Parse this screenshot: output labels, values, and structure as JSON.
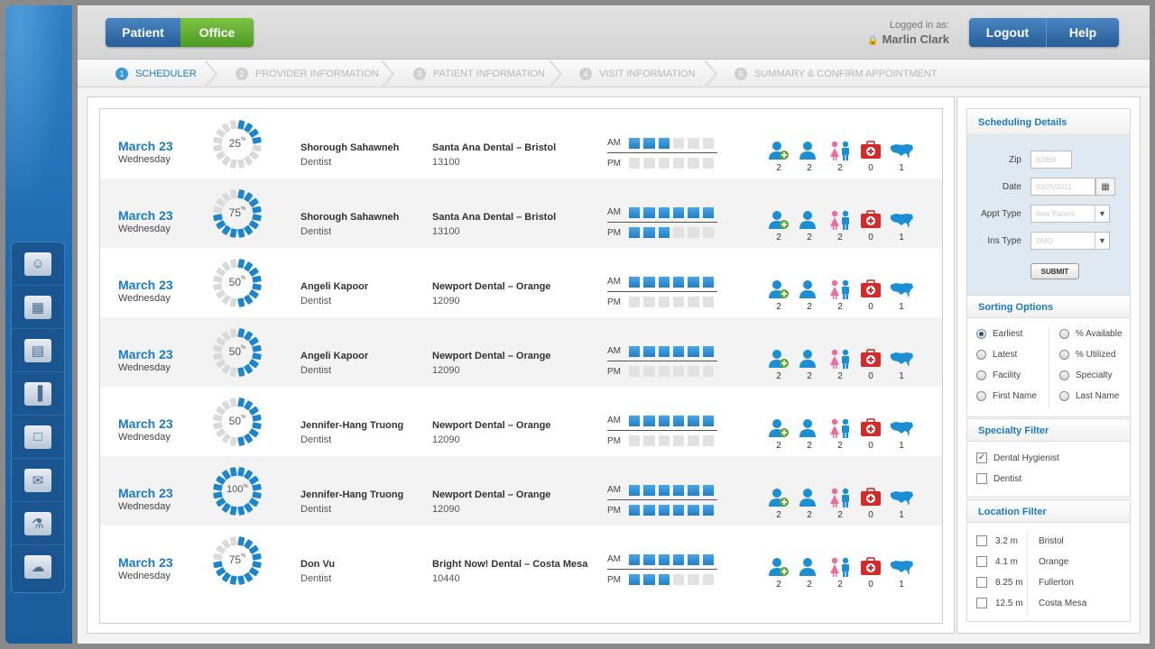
{
  "header": {
    "toggle": {
      "patient": "Patient",
      "office": "Office"
    },
    "logged_in_label": "Logged in as:",
    "user_name": "Marlin Clark",
    "logout": "Logout",
    "help": "Help"
  },
  "steps": [
    {
      "num": "1",
      "label": "SCHEDULER",
      "active": true
    },
    {
      "num": "2",
      "label": "PROVIDER INFORMATION",
      "active": false
    },
    {
      "num": "3",
      "label": "PATIENT INFORMATION",
      "active": false
    },
    {
      "num": "4",
      "label": "VISIT INFORMATION",
      "active": false
    },
    {
      "num": "5",
      "label": "SUMMARY & CONFIRM APPOINTMENT",
      "active": false
    }
  ],
  "slot_labels": {
    "am": "AM",
    "pm": "PM"
  },
  "appointments": [
    {
      "date": "March 23",
      "weekday": "Wednesday",
      "pct": 25,
      "provider": "Shorough Sahawneh",
      "role": "Dentist",
      "location": "Santa Ana Dental – Bristol",
      "zip": "13100",
      "am": [
        1,
        1,
        1,
        0,
        0,
        0
      ],
      "pm": [
        0,
        0,
        0,
        0,
        0,
        0
      ],
      "counts": [
        "2",
        "2",
        "2",
        "0",
        "1"
      ]
    },
    {
      "date": "March 23",
      "weekday": "Wednesday",
      "pct": 75,
      "provider": "Shorough Sahawneh",
      "role": "Dentist",
      "location": "Santa Ana Dental – Bristol",
      "zip": "13100",
      "am": [
        1,
        1,
        1,
        1,
        1,
        1
      ],
      "pm": [
        1,
        1,
        1,
        0,
        0,
        0
      ],
      "counts": [
        "2",
        "2",
        "2",
        "0",
        "1"
      ]
    },
    {
      "date": "March 23",
      "weekday": "Wednesday",
      "pct": 50,
      "provider": "Angeli Kapoor",
      "role": "Dentist",
      "location": "Newport Dental – Orange",
      "zip": "12090",
      "am": [
        1,
        1,
        1,
        1,
        1,
        1
      ],
      "pm": [
        0,
        0,
        0,
        0,
        0,
        0
      ],
      "counts": [
        "2",
        "2",
        "2",
        "0",
        "1"
      ]
    },
    {
      "date": "March 23",
      "weekday": "Wednesday",
      "pct": 50,
      "provider": "Angeli Kapoor",
      "role": "Dentist",
      "location": "Newport Dental – Orange",
      "zip": "12090",
      "am": [
        1,
        1,
        1,
        1,
        1,
        1
      ],
      "pm": [
        0,
        0,
        0,
        0,
        0,
        0
      ],
      "counts": [
        "2",
        "2",
        "2",
        "0",
        "1"
      ]
    },
    {
      "date": "March 23",
      "weekday": "Wednesday",
      "pct": 50,
      "provider": "Jennifer-Hang Truong",
      "role": "Dentist",
      "location": "Newport Dental – Orange",
      "zip": "12090",
      "am": [
        1,
        1,
        1,
        1,
        1,
        1
      ],
      "pm": [
        0,
        0,
        0,
        0,
        0,
        0
      ],
      "counts": [
        "2",
        "2",
        "2",
        "0",
        "1"
      ]
    },
    {
      "date": "March 23",
      "weekday": "Wednesday",
      "pct": 100,
      "provider": "Jennifer-Hang Truong",
      "role": "Dentist",
      "location": "Newport Dental – Orange",
      "zip": "12090",
      "am": [
        1,
        1,
        1,
        1,
        1,
        1
      ],
      "pm": [
        1,
        1,
        1,
        1,
        1,
        1
      ],
      "counts": [
        "2",
        "2",
        "2",
        "0",
        "1"
      ]
    },
    {
      "date": "March 23",
      "weekday": "Wednesday",
      "pct": 75,
      "provider": "Don Vu",
      "role": "Dentist",
      "location": "Bright Now! Dental – Costa Mesa",
      "zip": "10440",
      "am": [
        1,
        1,
        1,
        1,
        1,
        1
      ],
      "pm": [
        1,
        1,
        1,
        0,
        0,
        0
      ],
      "counts": [
        "2",
        "2",
        "2",
        "0",
        "1"
      ]
    }
  ],
  "scheduling": {
    "title": "Scheduling Details",
    "zip_label": "Zip",
    "zip_value": "92869",
    "date_label": "Date",
    "date_value": "03/25/2011",
    "appt_label": "Appt Type",
    "appt_value": "New Patient",
    "ins_label": "Ins Type",
    "ins_value": "DMO",
    "submit": "SUBMIT"
  },
  "sorting": {
    "title": "Sorting Options",
    "left": [
      {
        "label": "Earliest",
        "checked": true
      },
      {
        "label": "Latest",
        "checked": false
      },
      {
        "label": "Facility",
        "checked": false
      },
      {
        "label": "First Name",
        "checked": false
      }
    ],
    "right": [
      {
        "label": "% Available",
        "checked": false
      },
      {
        "label": "% Utilized",
        "checked": false
      },
      {
        "label": "Specialty",
        "checked": false
      },
      {
        "label": "Last Name",
        "checked": false
      }
    ]
  },
  "specialty": {
    "title": "Specialty Filter",
    "items": [
      {
        "label": "Dental Hygienist",
        "checked": true
      },
      {
        "label": "Dentist",
        "checked": false
      }
    ]
  },
  "location": {
    "title": "Location Filter",
    "items": [
      {
        "dist": "3.2 m",
        "city": "Bristol"
      },
      {
        "dist": "4.1 m",
        "city": "Orange"
      },
      {
        "dist": "8.25 m",
        "city": "Fullerton"
      },
      {
        "dist": "12.5 m",
        "city": "Costa Mesa"
      }
    ]
  },
  "colors": {
    "accent": "#1b7bc3",
    "green": "#5aab2c",
    "navy": "#2a5f96",
    "red": "#d62a2a",
    "pink": "#f06aa0"
  },
  "nav_icons": [
    "patients-icon",
    "calendar-icon",
    "folder-icon",
    "chart-icon",
    "window-icon",
    "mail-icon",
    "lab-icon",
    "chat-icon"
  ]
}
